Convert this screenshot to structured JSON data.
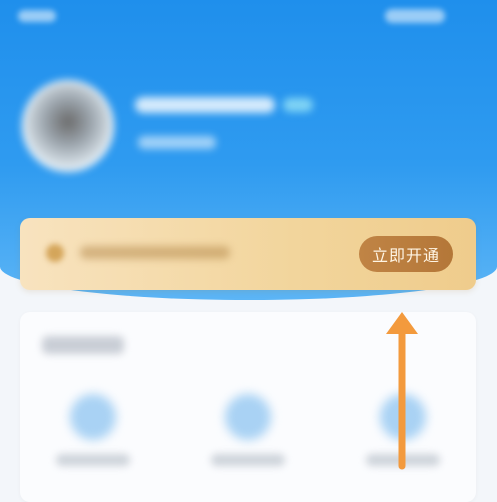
{
  "vip_banner": {
    "open_button_label": "立即开通"
  },
  "colors": {
    "header_blue": "#1f8fec",
    "banner_gold": "#f2d59c",
    "button_brown": "#b47738",
    "arrow_orange": "#f39a3d"
  },
  "icons": {
    "arrow": "up-arrow-icon"
  }
}
